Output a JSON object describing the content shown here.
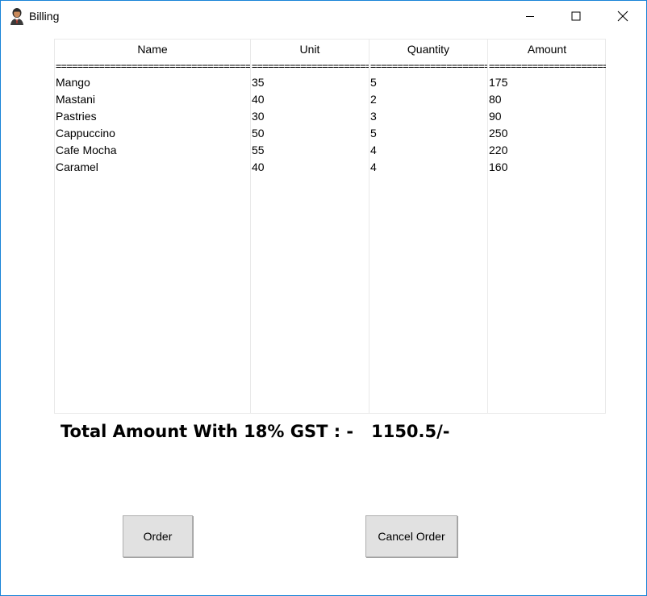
{
  "window": {
    "title": "Billing",
    "icon": "user-avatar-icon"
  },
  "controls": {
    "minimize": "minimize-icon",
    "maximize": "maximize-icon",
    "close": "close-icon"
  },
  "table": {
    "headers": [
      "Name",
      "Unit",
      "Quantity",
      "Amount"
    ],
    "separators": [
      "==========================================",
      "==========================================",
      "==========================================",
      "=========================================="
    ],
    "rows": [
      [
        "Mango",
        "35",
        "5",
        "175"
      ],
      [
        "Mastani",
        "40",
        "2",
        "80"
      ],
      [
        "Pastries",
        "30",
        "3",
        "90"
      ],
      [
        "Cappuccino",
        "50",
        "5",
        "250"
      ],
      [
        "Cafe Mocha",
        "55",
        "4",
        "220"
      ],
      [
        "Caramel",
        "40",
        "4",
        "160"
      ]
    ]
  },
  "summary": {
    "label": "Total Amount With 18% GST : -",
    "value": "1150.5/-"
  },
  "buttons": {
    "order": "Order",
    "cancel": "Cancel Order"
  },
  "colors": {
    "window_border": "#1883d7",
    "button_face": "#e1e1e1",
    "grid_line": "#e9e9e9"
  }
}
